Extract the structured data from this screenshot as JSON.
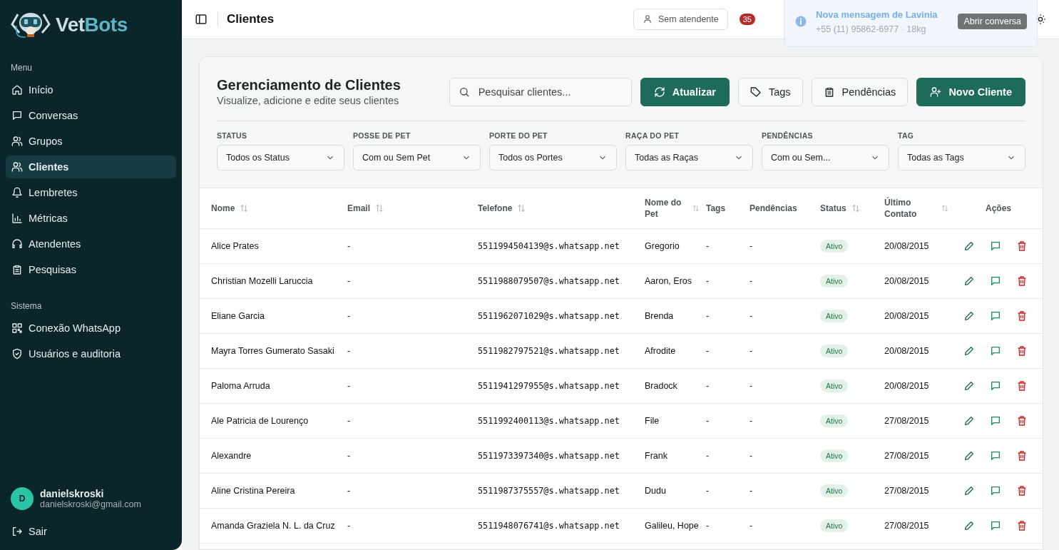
{
  "brand": {
    "parts": [
      "Vet",
      "Bots"
    ]
  },
  "sidebar": {
    "sections": [
      {
        "title": "Menu",
        "items": [
          {
            "label": "Início",
            "selected": false
          },
          {
            "label": "Conversas",
            "selected": false
          },
          {
            "label": "Grupos",
            "selected": false
          },
          {
            "label": "Clientes",
            "selected": true
          },
          {
            "label": "Lembretes",
            "selected": false
          },
          {
            "label": "Métricas",
            "selected": false
          },
          {
            "label": "Atendentes",
            "selected": false
          },
          {
            "label": "Pesquisas",
            "selected": false
          }
        ]
      },
      {
        "title": "Sistema",
        "items": [
          {
            "label": "Conexão WhatsApp",
            "selected": false
          },
          {
            "label": "Usuários e auditoria",
            "selected": false
          }
        ]
      }
    ],
    "user": {
      "initial": "D",
      "name": "danielskroski",
      "email": "danielskroski@gmail.com"
    },
    "logout": "Sair"
  },
  "header": {
    "title": "Clientes",
    "attendant_select": "Sem atendente",
    "badge": "35"
  },
  "toast": {
    "title": "Nova mensagem de Lavinia",
    "subtitle": "+55 (11) 95862-6977 · 18kg",
    "action": "Abrir conversa"
  },
  "page": {
    "title": "Gerenciamento de Clientes",
    "subtitle": "Visualize, adicione e edite seus clientes",
    "search": {
      "placeholder": "Pesquisar clientes..."
    },
    "buttons": [
      {
        "label": "Atualizar",
        "kind": "primary"
      },
      {
        "label": "Tags",
        "kind": "outline"
      },
      {
        "label": "Pendências",
        "kind": "outline"
      },
      {
        "label": "Novo Cliente",
        "kind": "primary"
      }
    ]
  },
  "filters": [
    {
      "label": "STATUS",
      "value": "Todos os Status"
    },
    {
      "label": "POSSE DE PET",
      "value": "Com ou Sem Pet"
    },
    {
      "label": "PORTE DO PET",
      "value": "Todos os Portes"
    },
    {
      "label": "RAÇA DO PET",
      "value": "Todas as Raças"
    },
    {
      "label": "PENDÊNCIAS",
      "value": "Com ou Sem..."
    },
    {
      "label": "TAG",
      "value": "Todas as Tags"
    }
  ],
  "table": {
    "columns": [
      {
        "label": "Nome",
        "sortable": true
      },
      {
        "label": "Email",
        "sortable": true
      },
      {
        "label": "Telefone",
        "sortable": true
      },
      {
        "label": "Nome do Pet",
        "sortable": true
      },
      {
        "label": "Tags",
        "sortable": false
      },
      {
        "label": "Pendências",
        "sortable": false
      },
      {
        "label": "Status",
        "sortable": true
      },
      {
        "label": "Último Contato",
        "sortable": true
      },
      {
        "label": "Ações",
        "sortable": false
      }
    ],
    "rows": [
      {
        "name": "Alice Prates",
        "email": "-",
        "phone": "5511994504139@s.whatsapp.net",
        "pet": "Gregorio",
        "tags": "-",
        "pending": "-",
        "status": "Ativo",
        "last": "20/08/2015"
      },
      {
        "name": "Christian Mozelli Laruccia",
        "email": "-",
        "phone": "5511988079507@s.whatsapp.net",
        "pet": "Aaron, Eros",
        "tags": "-",
        "pending": "-",
        "status": "Ativo",
        "last": "20/08/2015"
      },
      {
        "name": "Eliane Garcia",
        "email": "-",
        "phone": "5511962071029@s.whatsapp.net",
        "pet": "Brenda",
        "tags": "-",
        "pending": "-",
        "status": "Ativo",
        "last": "20/08/2015"
      },
      {
        "name": "Mayra Torres Gumerato Sasaki",
        "email": "-",
        "phone": "5511982797521@s.whatsapp.net",
        "pet": "Afrodite",
        "tags": "-",
        "pending": "-",
        "status": "Ativo",
        "last": "20/08/2015"
      },
      {
        "name": "Paloma Arruda",
        "email": "-",
        "phone": "5511941297955@s.whatsapp.net",
        "pet": "Bradock",
        "tags": "-",
        "pending": "-",
        "status": "Ativo",
        "last": "20/08/2015"
      },
      {
        "name": "Ale Patricia de Lourenço",
        "email": "-",
        "phone": "5511992400113@s.whatsapp.net",
        "pet": "File",
        "tags": "-",
        "pending": "-",
        "status": "Ativo",
        "last": "27/08/2015"
      },
      {
        "name": "Alexandre",
        "email": "-",
        "phone": "5511973397340@s.whatsapp.net",
        "pet": "Frank",
        "tags": "-",
        "pending": "-",
        "status": "Ativo",
        "last": "27/08/2015"
      },
      {
        "name": "Aline Cristina Pereira",
        "email": "-",
        "phone": "5511987375557@s.whatsapp.net",
        "pet": "Dudu",
        "tags": "-",
        "pending": "-",
        "status": "Ativo",
        "last": "27/08/2015"
      },
      {
        "name": "Amanda Graziela N. L. da Cruz",
        "email": "-",
        "phone": "5511948076741@s.whatsapp.net",
        "pet": "Galileu, Hope",
        "tags": "-",
        "pending": "-",
        "status": "Ativo",
        "last": "27/08/2015"
      }
    ]
  }
}
